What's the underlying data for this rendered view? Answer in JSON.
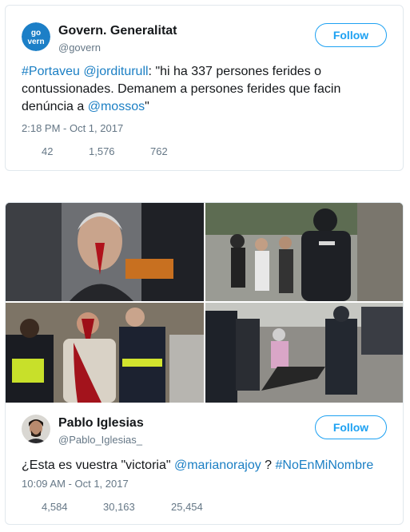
{
  "tweets": [
    {
      "avatar_text": "go\nvern",
      "avatar_color": "#1c7fc7",
      "name": "Govern. Generalitat",
      "handle": "@govern",
      "follow_label": "Follow",
      "text": [
        {
          "t": "#Portaveu",
          "link": true
        },
        {
          "t": " ",
          "link": false
        },
        {
          "t": "@jorditurull",
          "link": true
        },
        {
          "t": ": \"hi ha 337 persones ferides o contussionades. Demanem a persones ferides que facin denúncia a ",
          "link": false
        },
        {
          "t": "@mossos",
          "link": true
        },
        {
          "t": "\"",
          "link": false
        }
      ],
      "timestamp": "2:18 PM - Oct 1, 2017",
      "stats": [
        "42",
        "1,576",
        "762"
      ]
    },
    {
      "name": "Pablo Iglesias",
      "handle": "@Pablo_Iglesias_",
      "follow_label": "Follow",
      "text": [
        {
          "t": "¿Esta es vuestra \"victoria\" ",
          "link": false
        },
        {
          "t": "@marianorajoy",
          "link": true
        },
        {
          "t": " ? ",
          "link": false
        },
        {
          "t": "#NoEnMiNombre",
          "link": true
        }
      ],
      "timestamp": "10:09 AM - Oct 1, 2017",
      "stats": [
        "4,584",
        "30,163",
        "25,454"
      ]
    }
  ],
  "colors": {
    "link": "#1b7fc4",
    "follow": "#1da1f2",
    "muted": "#657786",
    "border": "#e1e8ed"
  }
}
